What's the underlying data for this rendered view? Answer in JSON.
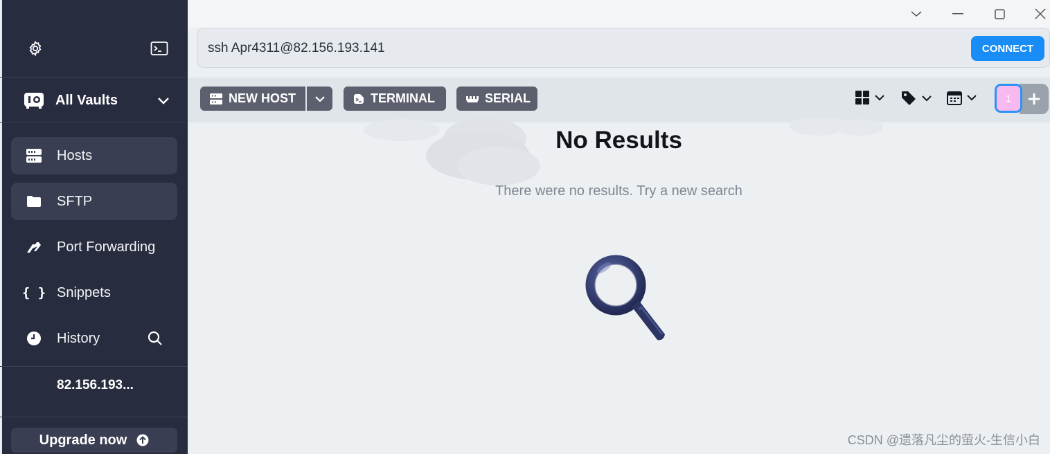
{
  "sidebar": {
    "vault_label": "All Vaults",
    "nav": [
      {
        "label": "Hosts",
        "icon": "hosts-icon",
        "active": true
      },
      {
        "label": "SFTP",
        "icon": "folder-icon",
        "active": true
      },
      {
        "label": "Port Forwarding",
        "icon": "port-forwarding-icon",
        "active": false
      },
      {
        "label": "Snippets",
        "icon": "braces-icon",
        "active": false
      },
      {
        "label": "History",
        "icon": "clock-icon",
        "active": false
      }
    ],
    "recent_host": "82.156.193...",
    "upgrade_label": "Upgrade now"
  },
  "address_bar": {
    "command": "ssh Apr4311@82.156.193.141",
    "connect_label": "CONNECT"
  },
  "toolbar": {
    "new_host_label": "NEW HOST",
    "terminal_label": "TERMINAL",
    "serial_label": "SERIAL",
    "badge_count": "1"
  },
  "empty_state": {
    "title": "No Results",
    "message": "There were no results. Try a new search"
  },
  "watermark": "CSDN @遗落凡尘的萤火-生信小白",
  "colors": {
    "sidebar_bg": "#282c3f",
    "accent": "#1a8cf5",
    "button_bg": "#5c606e",
    "badge_bg": "#f7b9ef"
  }
}
